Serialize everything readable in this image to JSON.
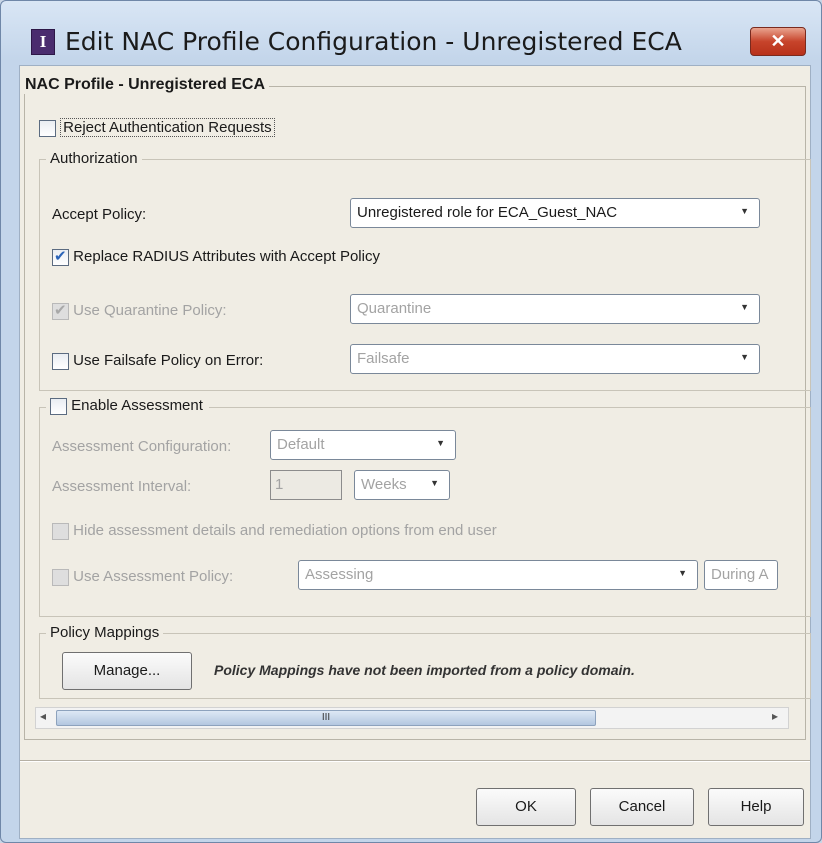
{
  "window": {
    "title": "Edit NAC Profile Configuration - Unregistered ECA",
    "icon_letter": "I",
    "close_glyph": "✕"
  },
  "profile": {
    "legend": "NAC Profile - Unregistered ECA",
    "reject_label": "Reject Authentication Requests",
    "reject_checked": false
  },
  "authorization": {
    "legend": "Authorization",
    "accept_policy_label": "Accept Policy:",
    "accept_policy_value": "Unregistered role for ECA_Guest_NAC",
    "replace_radius_label": "Replace RADIUS Attributes with Accept Policy",
    "replace_radius_checked": true,
    "quarantine_label": "Use Quarantine Policy:",
    "quarantine_value": "Quarantine",
    "failsafe_label": "Use Failsafe Policy on Error:",
    "failsafe_value": "Failsafe"
  },
  "assessment": {
    "enable_label": "Enable Assessment",
    "config_label": "Assessment Configuration:",
    "config_value": "Default",
    "interval_label": "Assessment Interval:",
    "interval_value": "1",
    "interval_unit": "Weeks",
    "hide_label": "Hide assessment details and remediation options from end user",
    "policy_label": "Use Assessment Policy:",
    "policy_value": "Assessing",
    "policy_extra": "During A"
  },
  "mappings": {
    "legend": "Policy Mappings",
    "manage_label": "Manage...",
    "note": "Policy Mappings have not been imported from a policy domain."
  },
  "scroll": {
    "left_arrow": "◂",
    "right_arrow": "▸",
    "grip": "III"
  },
  "footer": {
    "ok_label": "OK",
    "cancel_label": "Cancel",
    "help_label": "Help"
  }
}
